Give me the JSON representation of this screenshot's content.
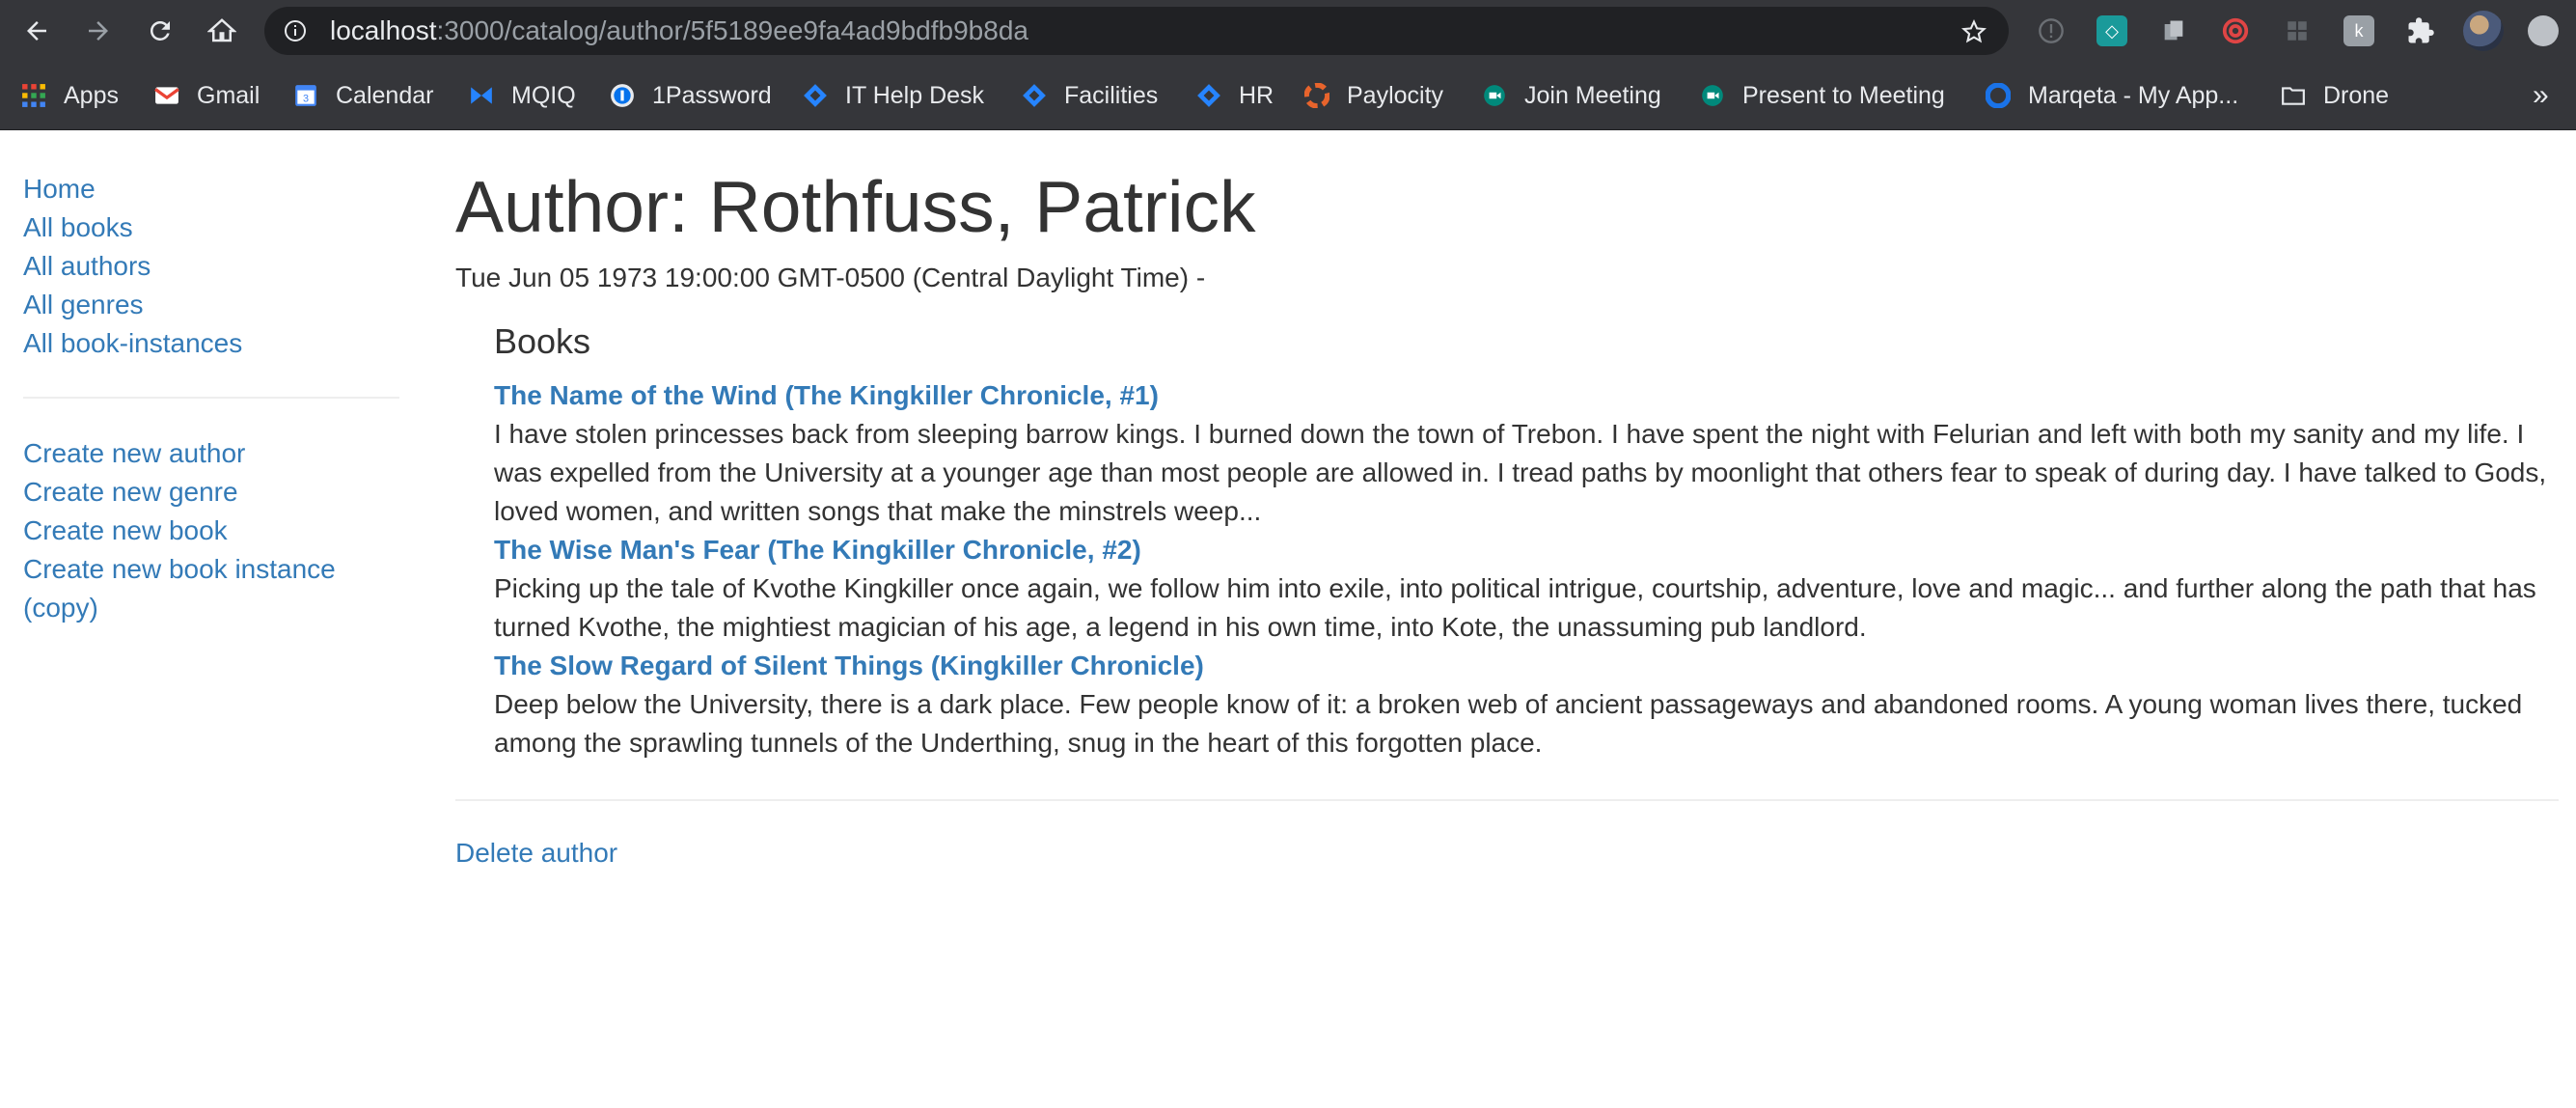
{
  "browser": {
    "url_host": "localhost",
    "url_path": ":3000/catalog/author/5f5189ee9fa4ad9bdfb9b8da",
    "bookmarks": [
      {
        "label": "Apps",
        "icon": "apps-grid-icon",
        "color": "#ea4335"
      },
      {
        "label": "Gmail",
        "icon": "gmail-icon",
        "color": "#ea4335"
      },
      {
        "label": "Calendar",
        "icon": "calendar-icon",
        "color": "#4285f4"
      },
      {
        "label": "MQIQ",
        "icon": "mqiq-icon",
        "color": "#2684ff"
      },
      {
        "label": "1Password",
        "icon": "1password-icon",
        "color": "#0572ec"
      },
      {
        "label": "IT Help Desk",
        "icon": "jira-icon",
        "color": "#2684ff"
      },
      {
        "label": "Facilities",
        "icon": "jira-icon",
        "color": "#2684ff"
      },
      {
        "label": "HR",
        "icon": "jira-icon",
        "color": "#2684ff"
      },
      {
        "label": "Paylocity",
        "icon": "paylocity-icon",
        "color": "#e8642c"
      },
      {
        "label": "Join Meeting",
        "icon": "meet-icon",
        "color": "#00897b"
      },
      {
        "label": "Present to Meeting",
        "icon": "meet-icon",
        "color": "#00897b"
      },
      {
        "label": "Marqeta - My App...",
        "icon": "okta-icon",
        "color": "#1a73e8"
      },
      {
        "label": "Drone",
        "icon": "folder-icon",
        "color": "#9aa0a6"
      }
    ],
    "more": "»"
  },
  "sidebar": {
    "nav": [
      "Home",
      "All books",
      "All authors",
      "All genres",
      "All book-instances"
    ],
    "actions": [
      "Create new author",
      "Create new genre",
      "Create new book",
      "Create new book instance (copy)"
    ]
  },
  "main": {
    "title": "Author: Rothfuss, Patrick",
    "dates": "Tue Jun 05 1973 19:00:00 GMT-0500 (Central Daylight Time) -",
    "books_heading": "Books",
    "books": [
      {
        "title": "The Name of the Wind (The Kingkiller Chronicle, #1)",
        "summary": "I have stolen princesses back from sleeping barrow kings. I burned down the town of Trebon. I have spent the night with Felurian and left with both my sanity and my life. I was expelled from the University at a younger age than most people are allowed in. I tread paths by moonlight that others fear to speak of during day. I have talked to Gods, loved women, and written songs that make the minstrels weep..."
      },
      {
        "title": "The Wise Man's Fear (The Kingkiller Chronicle, #2)",
        "summary": "Picking up the tale of Kvothe Kingkiller once again, we follow him into exile, into political intrigue, courtship, adventure, love and magic... and further along the path that has turned Kvothe, the mightiest magician of his age, a legend in his own time, into Kote, the unassuming pub landlord."
      },
      {
        "title": "The Slow Regard of Silent Things (Kingkiller Chronicle)",
        "summary": "Deep below the University, there is a dark place. Few people know of it: a broken web of ancient passageways and abandoned rooms. A young woman lives there, tucked among the sprawling tunnels of the Underthing, snug in the heart of this forgotten place."
      }
    ],
    "delete_label": "Delete author"
  },
  "colors": {
    "link": "#337ab7",
    "text": "#333333",
    "chrome": "#35363a",
    "omnibox": "#202124"
  }
}
